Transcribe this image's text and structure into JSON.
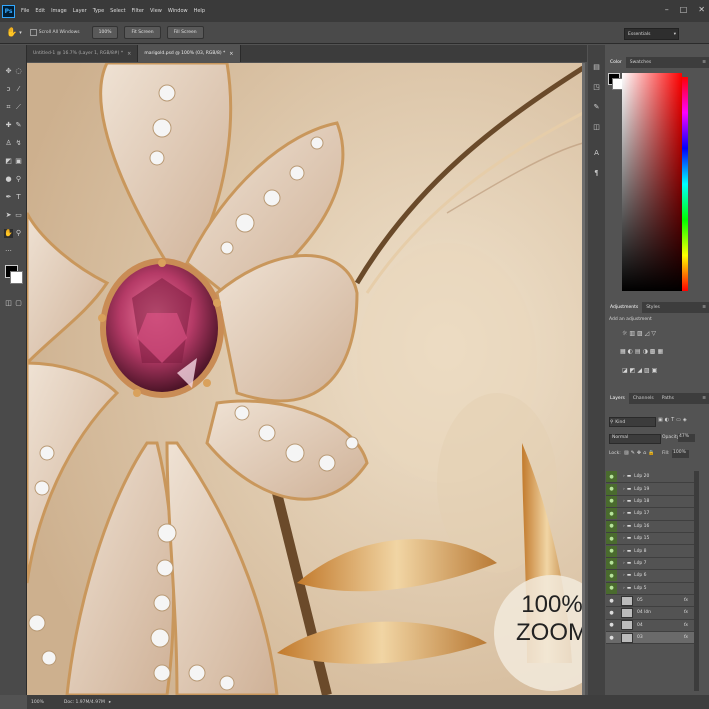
{
  "app": {
    "logo": "Ps"
  },
  "menu": [
    "File",
    "Edit",
    "Image",
    "Layer",
    "Type",
    "Select",
    "Filter",
    "View",
    "Window",
    "Help"
  ],
  "window_controls": [
    "–",
    "□",
    "✕"
  ],
  "options": {
    "scroll_all_windows": "Scroll All Windows",
    "btn_100": "100%",
    "btn_fit": "Fit Screen",
    "btn_fill": "Fill Screen",
    "workspace": "Essentials"
  },
  "tabs": [
    {
      "label": "Untitled-1 @ 16.7% (Layer 1, RGB/8#) *",
      "active": false,
      "close": "×"
    },
    {
      "label": "marigold.psd @ 100% (03, RGB/8) *",
      "active": true,
      "close": "×"
    }
  ],
  "canvas": {
    "zoom_line1": "100%",
    "zoom_line2": "ZOOM"
  },
  "color_panel": {
    "tabs": [
      "Color",
      "Swatches"
    ]
  },
  "adjustments_panel": {
    "tabs": [
      "Adjustments",
      "Styles"
    ],
    "hint": "Add an adjustment"
  },
  "layers_panel": {
    "tabs": [
      "Layers",
      "Channels",
      "Paths"
    ],
    "kind": "Kind",
    "blend_mode": "Normal",
    "opacity_label": "Opacity:",
    "opacity_value": "47%",
    "lock_label": "Lock:",
    "fill_label": "Fill:",
    "fill_value": "100%",
    "groups": [
      "Lớp 20",
      "Lớp 19",
      "Lớp 18",
      "Lớp 17",
      "Lớp 16",
      "Lớp 15",
      "Lớp 8",
      "Lớp 7",
      "Lớp 6",
      "Lớp 5"
    ],
    "layers": [
      "05",
      "04 lớn",
      "04",
      "03"
    ],
    "fx": "fx"
  },
  "status": {
    "zoom": "100%",
    "doc": "Doc: 1.97M/4.97M"
  },
  "colors": {
    "accent": "#31a8ff",
    "bg": "#535353",
    "dark": "#3a3a3a",
    "visible_green": "#4a6b2e"
  }
}
